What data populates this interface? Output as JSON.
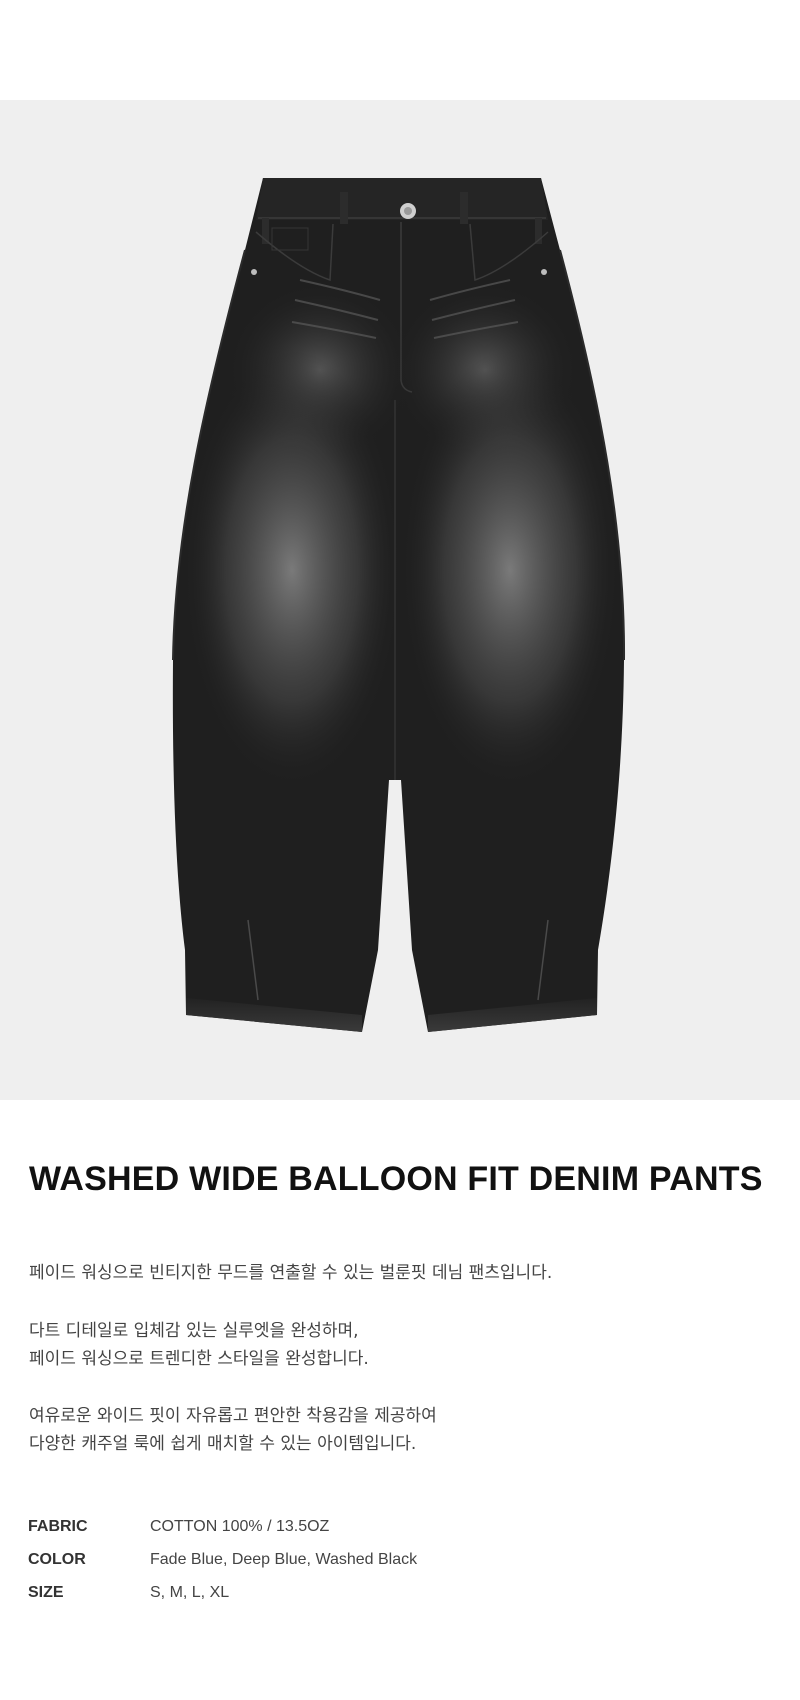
{
  "product": {
    "image_alt": "washed-black-balloon-denim-pants",
    "title": "WASHED WIDE BALLOON FIT DENIM PANTS",
    "paragraphs": [
      [
        "페이드 워싱으로 빈티지한 무드를 연출할 수 있는 벌룬핏 데님 팬츠입니다."
      ],
      [
        "다트 디테일로 입체감 있는 실루엣을 완성하며,",
        "페이드 워싱으로 트렌디한 스타일을 완성합니다."
      ],
      [
        "여유로운 와이드 핏이 자유롭고 편안한 착용감을 제공하여",
        "다양한 캐주얼 룩에 쉽게 매치할 수 있는 아이템입니다."
      ]
    ],
    "specs": [
      {
        "key": "FABRIC",
        "value": "COTTON 100%  /  13.5OZ"
      },
      {
        "key": "COLOR",
        "value": "Fade Blue, Deep Blue, Washed Black"
      },
      {
        "key": "SIZE",
        "value": "S, M, L, XL"
      }
    ]
  },
  "colors": {
    "hero_bg": "#efefef",
    "denim_dark": "#1f1f1f",
    "denim_fade": "#6a6a6a",
    "text": "#222222"
  }
}
